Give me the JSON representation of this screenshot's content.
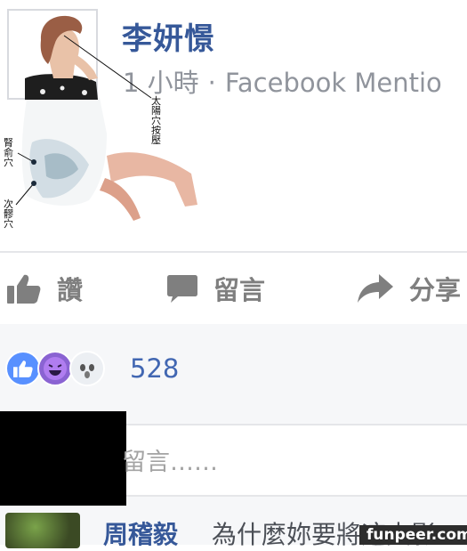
{
  "post": {
    "author_name": "李妍憬",
    "time": "1 小時",
    "separator": "·",
    "source": "Facebook Mentio"
  },
  "figure": {
    "label_taiyang": "太陽穴按壓",
    "label_shenyu": "腎俞穴",
    "label_ciliao": "次髎穴"
  },
  "actions": {
    "like_label": "讚",
    "comment_label": "留言",
    "share_label": "分享"
  },
  "reactions": {
    "count": "528",
    "types": [
      "like",
      "haha",
      "wow"
    ]
  },
  "comment_box": {
    "placeholder": "留言……"
  },
  "first_comment": {
    "author": "周稽毅",
    "text": "為什麼妳要將這支影"
  },
  "watermark": "funpeer.com",
  "colors": {
    "brand_blue": "#365899",
    "count_blue": "#4267b2",
    "muted": "#90949c"
  }
}
